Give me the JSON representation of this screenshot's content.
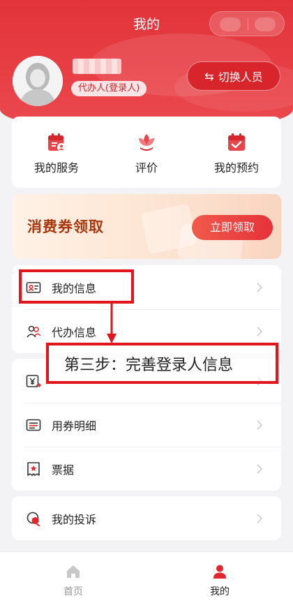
{
  "header": {
    "title": "我的"
  },
  "profile": {
    "username": "",
    "role_badge": "代办人(登录人)",
    "switch_label": "切换人员"
  },
  "quick_actions": [
    {
      "label": "我的服务",
      "icon": "calendar-user-icon"
    },
    {
      "label": "评价",
      "icon": "lotus-icon"
    },
    {
      "label": "我的预约",
      "icon": "calendar-check-icon"
    }
  ],
  "coupon": {
    "title": "消费券领取",
    "button": "立即领取"
  },
  "menu_group1": [
    {
      "label": "我的信息",
      "icon": "id-card-icon"
    },
    {
      "label": "代办信息",
      "icon": "users-icon"
    }
  ],
  "menu_group2": [
    {
      "label": "",
      "icon": "yen-transfer-icon"
    },
    {
      "label": "用券明细",
      "icon": "list-icon"
    },
    {
      "label": "票据",
      "icon": "receipt-icon"
    }
  ],
  "menu_group3": [
    {
      "label": "我的投诉",
      "icon": "complaint-icon"
    }
  ],
  "annotation": {
    "text": "第三步：完善登录人信息"
  },
  "tabbar": [
    {
      "label": "首页",
      "icon": "home-icon",
      "active": false
    },
    {
      "label": "我的",
      "icon": "person-icon",
      "active": true
    }
  ],
  "colors": {
    "brand_red": "#e2333a",
    "annotation_red": "#e3141b",
    "inactive": "#999999"
  }
}
